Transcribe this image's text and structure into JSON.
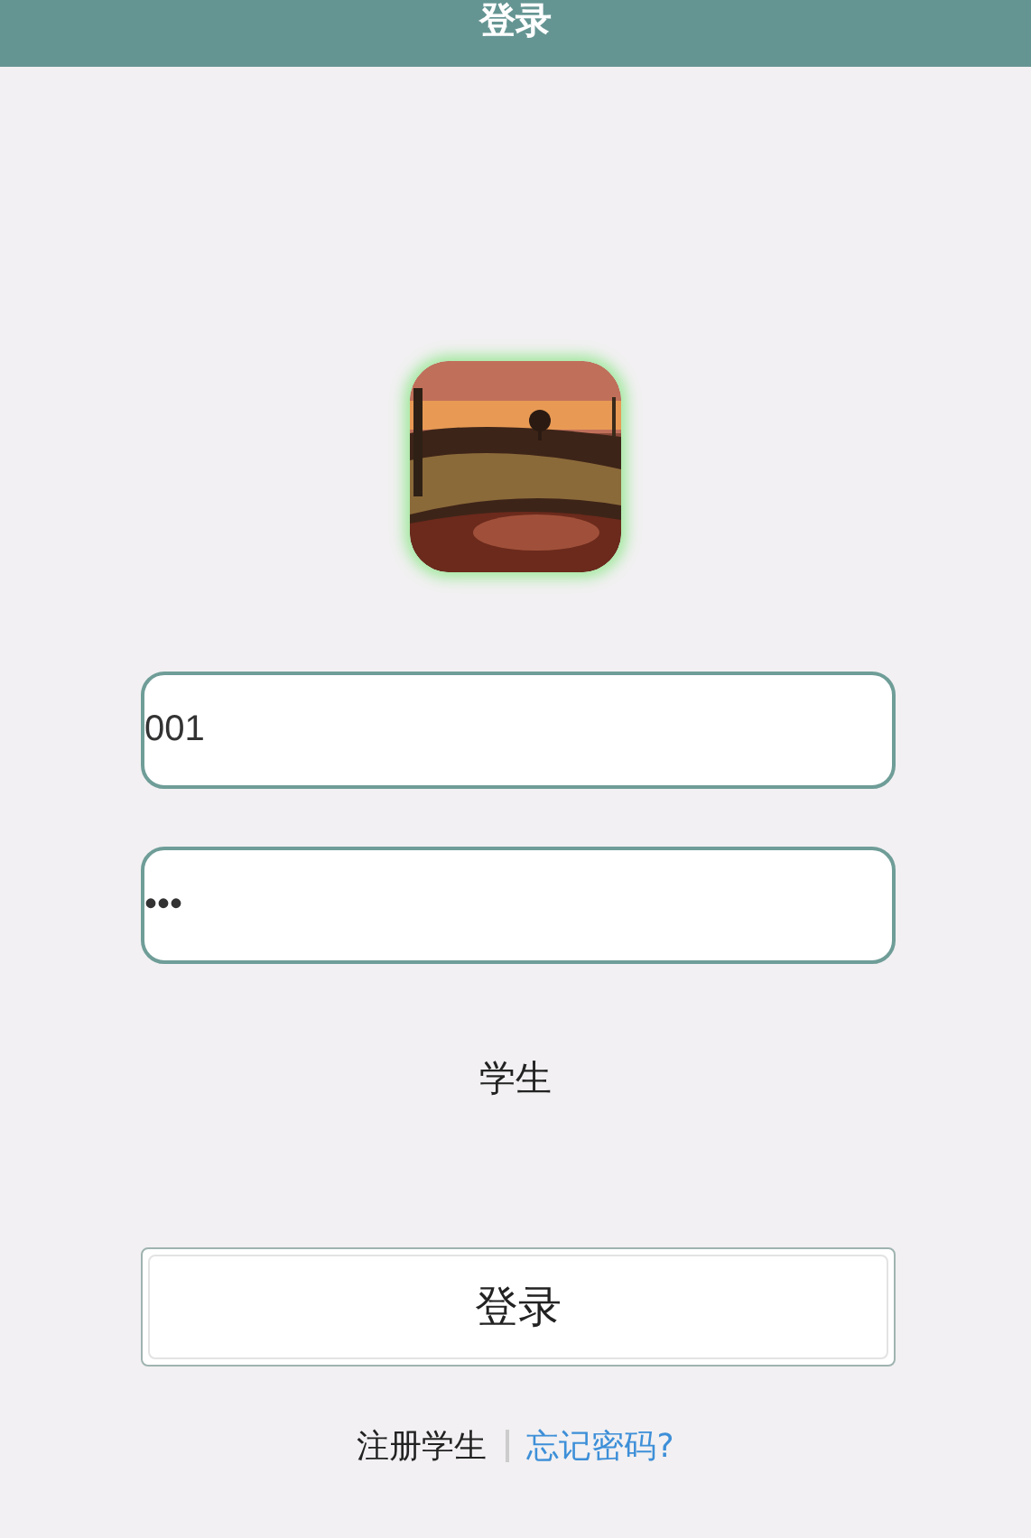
{
  "header": {
    "title": "登录"
  },
  "fields": [
    {
      "value": "001"
    },
    {
      "value": "•••"
    }
  ],
  "role": "学生",
  "login_button": "登录",
  "links": [
    {
      "label": "注册学生",
      "kind": "plain"
    },
    {
      "label": "忘记密码?",
      "kind": "link"
    }
  ]
}
